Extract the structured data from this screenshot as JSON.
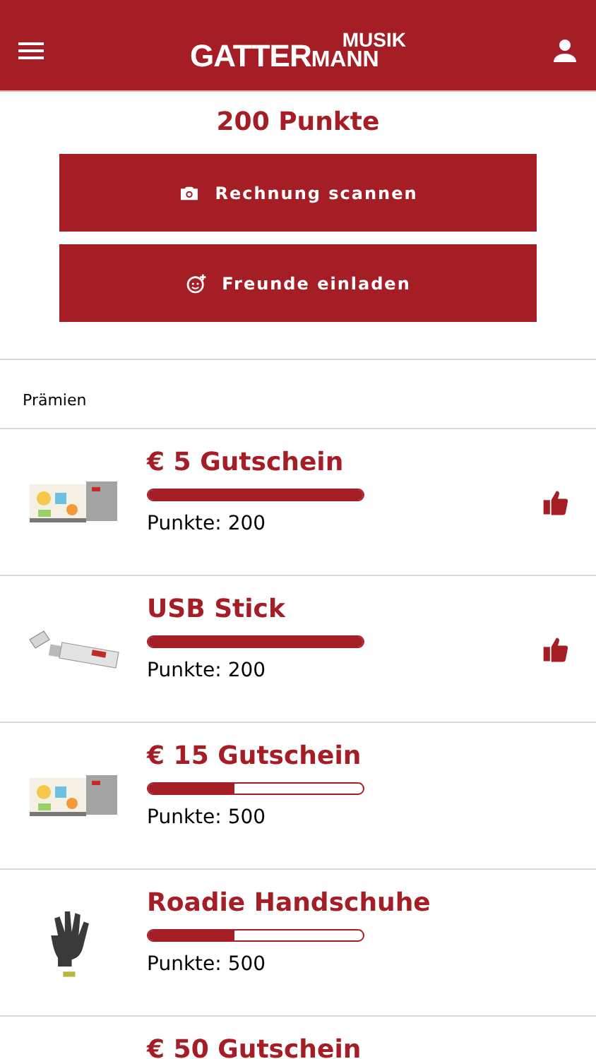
{
  "header": {
    "logo": {
      "left": "GATTER",
      "top": "MUSIK",
      "bottom": "MANN"
    }
  },
  "points": "200 Punkte",
  "actions": [
    {
      "kind": "camera",
      "label": "Rechnung scannen"
    },
    {
      "kind": "invite",
      "label": "Freunde einladen"
    }
  ],
  "section_title": "Prämien",
  "rewards": [
    {
      "title": "€ 5 Gutschein",
      "level": 1,
      "points": "Punkte: 200",
      "achieved": true
    },
    {
      "title": "USB Stick",
      "level": 1,
      "points": "Punkte: 200",
      "achieved": true
    },
    {
      "title": "€ 15 Gutschein",
      "level": 0.4,
      "points": "Punkte: 500",
      "achieved": false
    },
    {
      "title": "Roadie Handschuhe",
      "level": 0.4,
      "points": "Punkte: 500",
      "achieved": false
    },
    {
      "title": "€ 50 Gutschein"
    }
  ]
}
